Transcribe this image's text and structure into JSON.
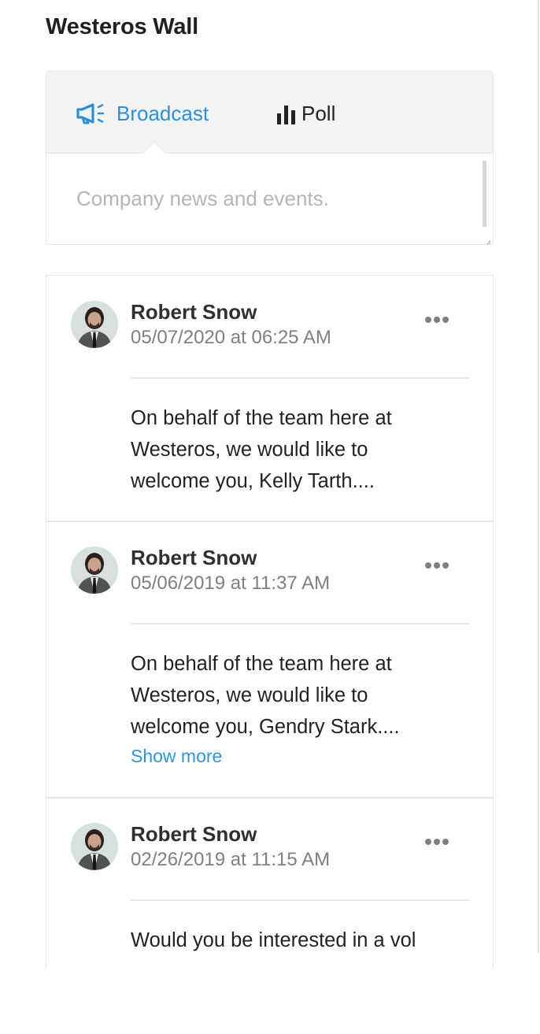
{
  "page": {
    "title": "Westeros Wall"
  },
  "composer": {
    "tabs": [
      {
        "label": "Broadcast",
        "icon": "megaphone-icon",
        "active": true
      },
      {
        "label": "Poll",
        "icon": "bar-chart-icon",
        "active": false
      }
    ],
    "placeholder": "Company news and events.",
    "value": ""
  },
  "colors": {
    "accent": "#2f8ed6",
    "link": "#2f95d6",
    "muted_text": "#7d7f85",
    "tab_bar_bg": "#f2f3f5"
  },
  "posts": [
    {
      "author": "Robert Snow",
      "date": "05/07/2020 at 06:25 AM",
      "lines": [
        "On behalf of the team here at",
        "Westeros, we would like to",
        "welcome you, Kelly Tarth...."
      ],
      "show_more": null
    },
    {
      "author": "Robert Snow",
      "date": "05/06/2019 at 11:37 AM",
      "lines": [
        "On behalf of the team here at",
        "Westeros, we would like to",
        "welcome you, Gendry Stark...."
      ],
      "show_more": "Show more"
    },
    {
      "author": "Robert Snow",
      "date": "02/26/2019 at 11:15 AM",
      "lines": [
        "Would you be interested in a vol"
      ],
      "show_more": null
    }
  ]
}
